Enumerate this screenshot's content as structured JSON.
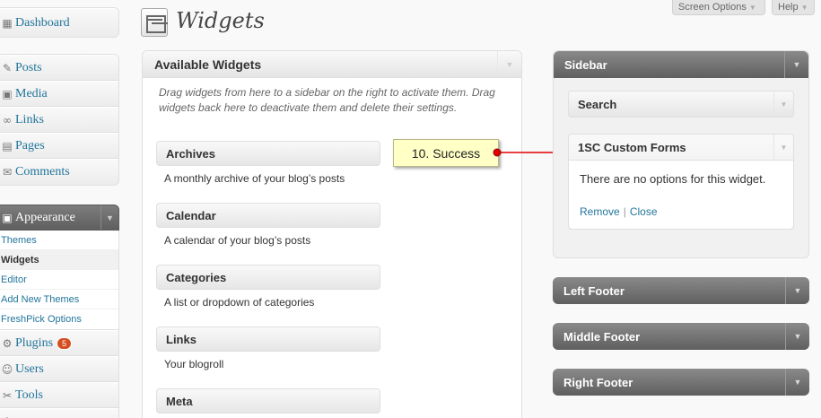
{
  "menu": {
    "dashboard": "Dashboard",
    "posts": "Posts",
    "media": "Media",
    "links": "Links",
    "pages": "Pages",
    "comments": "Comments",
    "appearance": "Appearance",
    "submenu": [
      "Themes",
      "Widgets",
      "Editor",
      "Add New Themes",
      "FreshPick Options"
    ],
    "current_submenu": "Widgets",
    "plugins": "Plugins",
    "plugins_badge": "5",
    "users": "Users",
    "tools": "Tools"
  },
  "header": {
    "title": "Widgets",
    "screen_options": "Screen Options",
    "help": "Help"
  },
  "available": {
    "title": "Available Widgets",
    "description": "Drag widgets from here to a sidebar on the right to activate them. Drag widgets back here to deactivate them and delete their settings.",
    "widgets": [
      {
        "name": "Archives",
        "desc": "A monthly archive of your blog’s posts"
      },
      {
        "name": "Calendar",
        "desc": "A calendar of your blog’s posts"
      },
      {
        "name": "Categories",
        "desc": "A list or dropdown of categories"
      },
      {
        "name": "Links",
        "desc": "Your blogroll"
      },
      {
        "name": "Meta",
        "desc": ""
      }
    ]
  },
  "callout": {
    "text": "10. Success"
  },
  "sidebar": {
    "title": "Sidebar",
    "widgets": [
      {
        "name": "Search"
      },
      {
        "name": "1SC Custom Forms",
        "body": "There are no options for this widget.",
        "remove": "Remove",
        "close": "Close"
      }
    ]
  },
  "footers": [
    "Left Footer",
    "Middle Footer",
    "Right Footer"
  ],
  "colors": {
    "link": "#21759b",
    "dark_header": "#5f5f5f",
    "badge": "#d54e21",
    "callout_bg": "#ffffc6",
    "arrow": "#e00000"
  }
}
